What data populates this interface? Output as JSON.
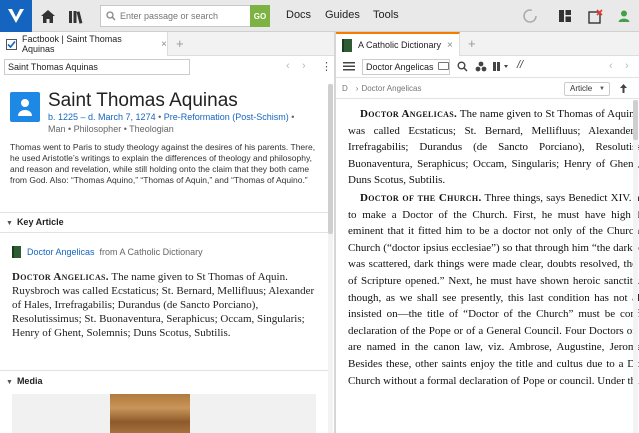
{
  "topbar": {
    "search_placeholder": "Enter passage or search",
    "go_label": "GO",
    "menu": [
      "Docs",
      "Guides",
      "Tools"
    ]
  },
  "left_panel": {
    "tab_title": "Factbook | Saint Thomas Aquinas",
    "search_value": "Saint Thomas Aquinas",
    "person": {
      "name": "Saint Thomas Aquinas",
      "dates": "b. 1225 – d. March 7, 1274",
      "era": "Pre-Reformation (Post-Schism)",
      "tags": "Man  •  Philosopher  •  Theologian"
    },
    "bio": "Thomas went to Paris to study theology against the desires of his parents. There, he used Aristotle’s writings to explain the differences of theology and philosophy, and reason and revelation, while still holding onto the claim that they both came from God. Also: “Thomas Aquino,” “Thomas of Aquin,” and “Thomas of Aquino.”",
    "key_article_heading": "Key Article",
    "key_article_link": "Doctor Angelicas",
    "key_article_source": "from A Catholic Dictionary",
    "key_article_term": "Doctor Angelicas.",
    "key_article_body": " The name given to St Thomas of Aquin. Ruysbroch was called Ecstaticus; St. Bernard, Mellifluus; Alexander of Hales, Irrefragabilis; Durandus (de Sancto Porciano), Resolutissimus; St. Buonaventura, Seraphicus; Occam, Singularis; Henry of Ghent, Solemnis; Duns Scotus, Subtilis.",
    "media_heading": "Media"
  },
  "right_panel": {
    "tab_title": "A Catholic Dictionary",
    "search_value": "Doctor Angelicas",
    "breadcrumb": "Doctor Angelicas",
    "article_label": "Article",
    "p1_term": "Doctor Angelicas.",
    "p1_body": " The name given to St Thomas of Aquin. Ruysbroch was called Ecstaticus; St. Bernard, Mellifluus; Alexander of Hales, Irrefragabilis; Durandus (de Sancto Porciano), Resolutissimus; St. Buonaventura, Seraphicus; Occam, Singularis; Henry of Ghent, Solemnis; Duns Scotus, Subtilis.",
    "p2_term": "Doctor of the Church.",
    "p2_body": " Three things, says Benedict XIV. are required to make a Doctor of the Church. First, he must have high learning so eminent that it fitted him to be a doctor not only of the Church but of the Church (“doctor ipsius ecclesiae”) so that through him “the darkness of error was scattered, dark things were made clear, doubts resolved, the difficulties of Scripture opened.” Next, he must have shown heroic sanctity. Thirdly—though, as we shall see presently, this last condition has not always been insisted on—the title of “Doctor of the Church” must be conferred by a declaration of the Pope or of a General Council. Four Doctors of the Church are named in the canon law, viz. Ambrose, Augustine, Jerome, Gregory. Besides these, other saints enjoy the title and cultus due to a Doctor of the Church without a formal declaration of Pope or council. Under this class"
  }
}
